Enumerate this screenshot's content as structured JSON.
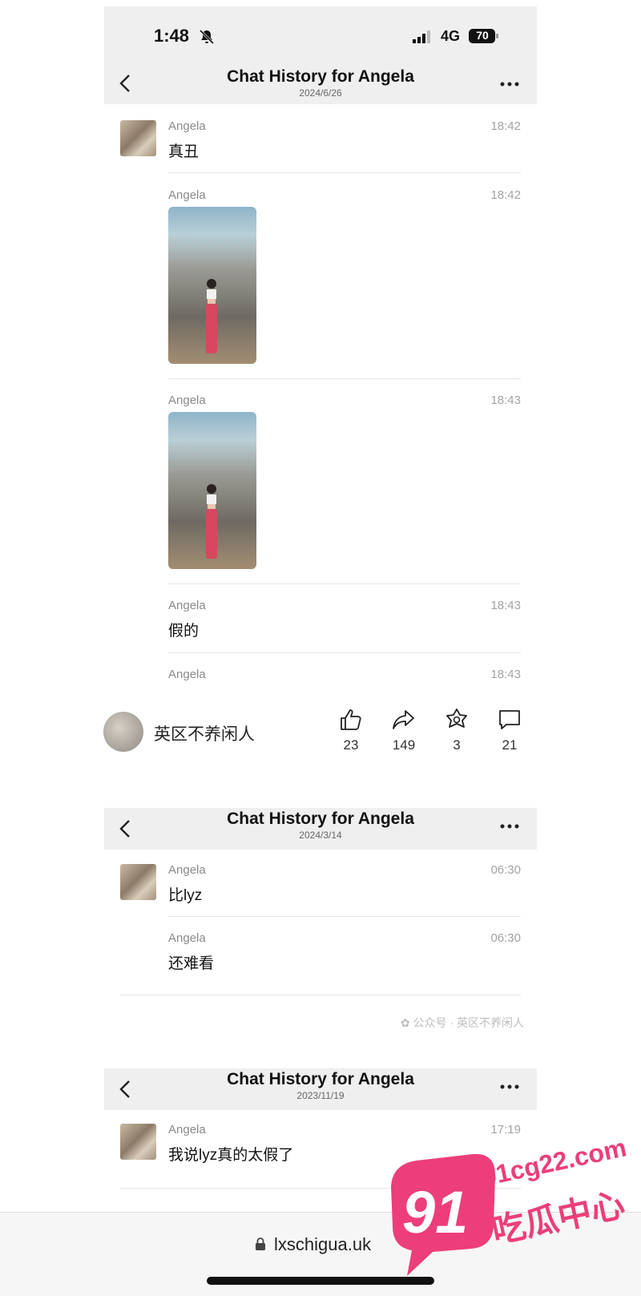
{
  "status_bar": {
    "time": "1:48",
    "network": "4G",
    "battery": "70"
  },
  "screens": [
    {
      "title": "Chat History for Angela",
      "date": "2024/6/26",
      "messages": [
        {
          "sender": "Angela",
          "time": "18:42",
          "text": "真丑"
        },
        {
          "sender": "Angela",
          "time": "18:42",
          "image": "photo"
        },
        {
          "sender": "Angela",
          "time": "18:43",
          "image": "photo"
        },
        {
          "sender": "Angela",
          "time": "18:43",
          "text": "假的"
        },
        {
          "sender": "Angela",
          "time": "18:43"
        }
      ]
    },
    {
      "title": "Chat History for Angela",
      "date": "2024/3/14",
      "messages": [
        {
          "sender": "Angela",
          "time": "06:30",
          "text": "比lyz"
        },
        {
          "sender": "Angela",
          "time": "06:30",
          "text": "还难看"
        }
      ],
      "footer": "公众号 · 英区不养闲人"
    },
    {
      "title": "Chat History for Angela",
      "date": "2023/11/19",
      "messages": [
        {
          "sender": "Angela",
          "time": "17:19",
          "text": "我说lyz真的太假了"
        }
      ]
    }
  ],
  "social": {
    "account_name": "英区不养闲人",
    "likes": "23",
    "shares": "149",
    "favorites": "3",
    "comments": "21"
  },
  "browser": {
    "url": "lxschigua.uk"
  },
  "site_logo": {
    "number": "91",
    "domain": "91cg22.com",
    "name": "吃瓜中心"
  }
}
